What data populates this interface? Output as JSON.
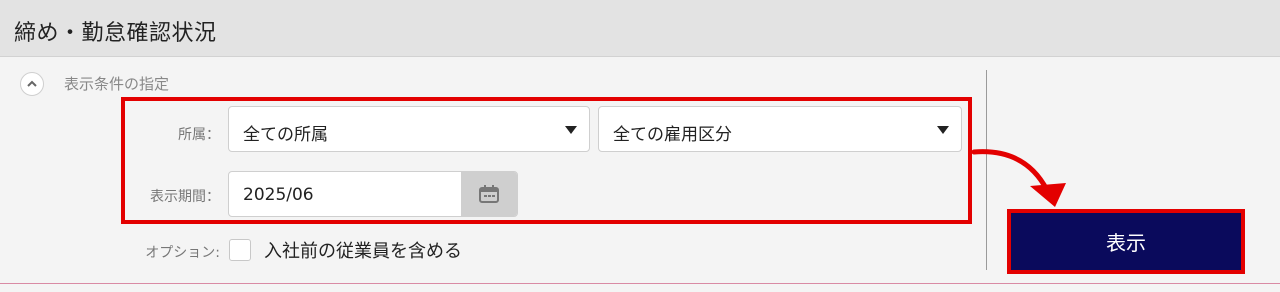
{
  "header": {
    "title": "締め・勤怠確認状況"
  },
  "conditions": {
    "section_label": "表示条件の指定",
    "affiliation_label": "所属：",
    "affiliation_value": "全ての所属",
    "employment_value": "全ての雇用区分",
    "period_label": "表示期間：",
    "period_value": "2025/06",
    "option_label": "オプション:",
    "option_text": "入社前の従業員を含める",
    "option_checked": false
  },
  "actions": {
    "show_label": "表示"
  },
  "annotation": {
    "highlight_color": "#e30000"
  },
  "icons": {
    "collapse": "chevron-up-icon",
    "calendar": "calendar-icon",
    "dropdown": "caret-down-icon"
  },
  "colors": {
    "button_bg": "#0a0a5c",
    "accent_red": "#e30000"
  }
}
